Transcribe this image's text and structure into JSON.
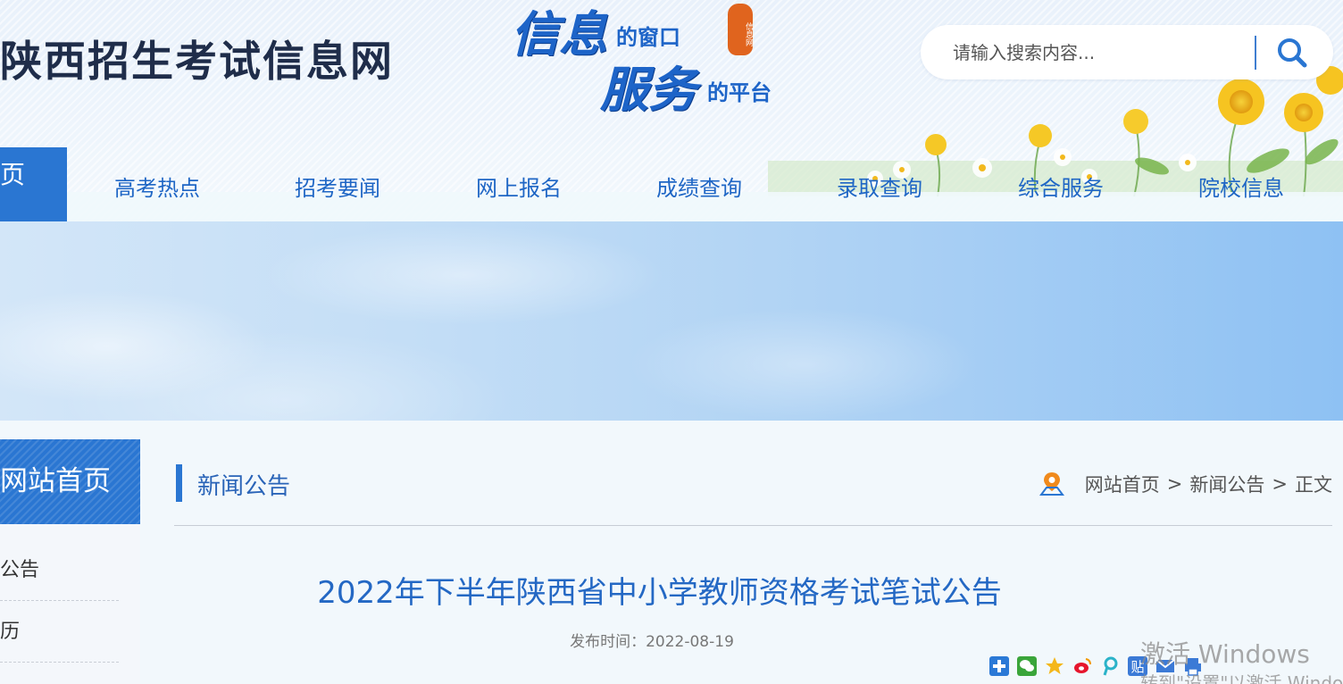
{
  "header": {
    "site_title": "陕西招生考试信息网",
    "slogan": {
      "line1_big": "信息",
      "line1_small": "的窗口",
      "line2_big": "服务",
      "line2_small": "的平台",
      "seal_text": "信息网"
    }
  },
  "search": {
    "placeholder": "请输入搜索内容...",
    "icon": "search-icon"
  },
  "nav": {
    "home_label": "页",
    "items": [
      "高考热点",
      "招考要闻",
      "网上报名",
      "成绩查询",
      "录取查询",
      "综合服务",
      "院校信息"
    ]
  },
  "sidebar": {
    "header": "网站首页",
    "items": [
      "公告",
      "历"
    ]
  },
  "section": {
    "title": "新闻公告",
    "breadcrumb": [
      "网站首页",
      "新闻公告",
      "正文"
    ],
    "breadcrumb_sep": ">",
    "location_icon": "location-pin-icon"
  },
  "article": {
    "title": "2022年下半年陕西省中小学教师资格考试笔试公告",
    "publish_time": "发布时间：2022-08-19"
  },
  "share_icons": [
    "share-plus-icon",
    "wechat-icon",
    "qzone-icon",
    "weibo-icon",
    "pengyou-icon",
    "tieba-icon",
    "email-icon",
    "print-icon"
  ],
  "watermark": {
    "line1": "激活 Windows",
    "line2": "转到\"设置\"以激活 Windows"
  },
  "colors": {
    "primary": "#2a76d2",
    "nav_text": "#1f66c5",
    "title_blue": "#2468c4",
    "banner_sky": "#8ec1f3"
  }
}
